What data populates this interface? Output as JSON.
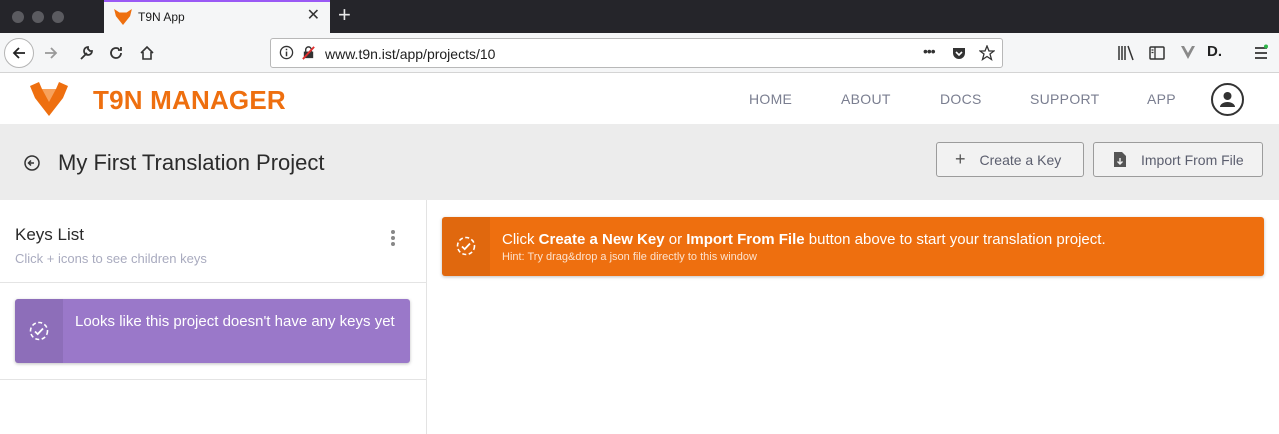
{
  "browser": {
    "tab_title": "T9N App",
    "tab_close": "✕",
    "new_tab": "+",
    "url": "www.t9n.ist/app/projects/10",
    "url_more": "•••",
    "toolbar_text_icon": "D."
  },
  "header": {
    "brand": "T9N MANAGER",
    "nav": [
      {
        "label": "HOME"
      },
      {
        "label": "ABOUT"
      },
      {
        "label": "DOCS"
      },
      {
        "label": "SUPPORT"
      },
      {
        "label": "APP"
      }
    ]
  },
  "project": {
    "title": "My First Translation Project",
    "create_key_label": "Create a Key",
    "create_key_icon": "+",
    "import_label": "Import From File"
  },
  "keys_panel": {
    "title": "Keys List",
    "subtitle": "Click + icons to see children keys",
    "empty_message": "Looks like this project doesn't have any keys yet"
  },
  "banner": {
    "prefix": "Click ",
    "create_text": "Create a New Key",
    "middle": " or ",
    "import_text": "Import From File",
    "suffix": " button above to start your translation project.",
    "hint": "Hint: Try drag&drop a json file directly to this window"
  },
  "colors": {
    "brand_orange": "#ee6f0f",
    "empty_purple": "#9a78c9",
    "tab_accent": "#9a59f5"
  }
}
